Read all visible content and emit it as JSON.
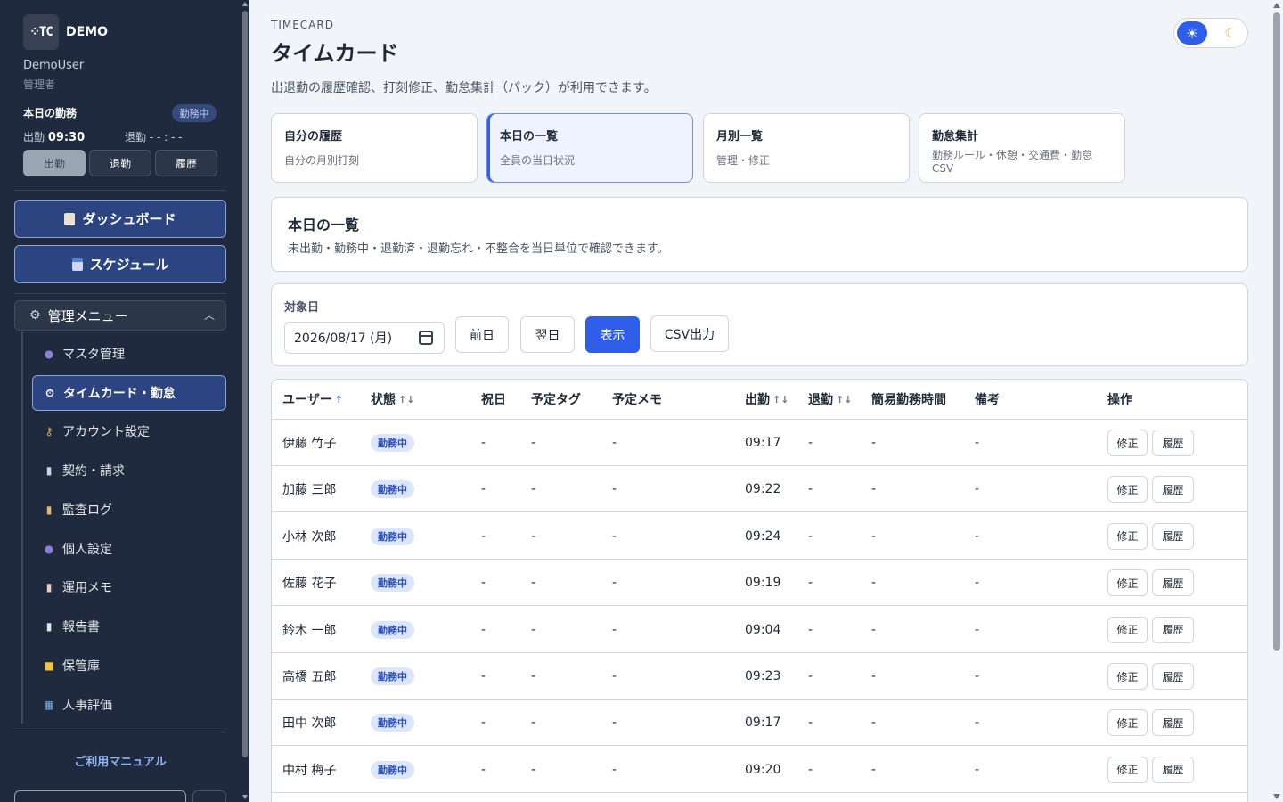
{
  "sidebar": {
    "logo_mark": "⁘TC",
    "logo_text": "DEMO",
    "user_name": "DemoUser",
    "user_role": "管理者",
    "today_label": "本日の勤務",
    "today_status": "勤務中",
    "clock_in_label": "出勤",
    "clock_in_time": "09:30",
    "clock_out_label": "退勤",
    "clock_out_time": "- - : - -",
    "punch_buttons": [
      "出勤",
      "退勤",
      "履歴"
    ],
    "dashboard_label": "ダッシュボード",
    "schedule_label": "スケジュール",
    "admin_menu_label": "管理メニュー",
    "nav_items": [
      {
        "label": "マスタ管理",
        "icon": "users-icon"
      },
      {
        "label": "タイムカード・勤怠",
        "icon": "stopwatch-icon"
      },
      {
        "label": "アカウント設定",
        "icon": "key-icon"
      },
      {
        "label": "契約・請求",
        "icon": "receipt-icon"
      },
      {
        "label": "監査ログ",
        "icon": "scroll-icon"
      },
      {
        "label": "個人設定",
        "icon": "person-icon"
      },
      {
        "label": "運用メモ",
        "icon": "memo-icon"
      },
      {
        "label": "報告書",
        "icon": "document-icon"
      },
      {
        "label": "保管庫",
        "icon": "folder-icon"
      },
      {
        "label": "人事評価",
        "icon": "bar-chart-icon"
      }
    ],
    "manual_link": "ご利用マニュアル"
  },
  "header": {
    "kicker": "TIMECARD",
    "title": "タイムカード",
    "description": "出退勤の履歴確認、打刻修正、勤怠集計（パック）が利用できます。"
  },
  "tabs": [
    {
      "title": "自分の履歴",
      "subtitle": "自分の月別打刻"
    },
    {
      "title": "本日の一覧",
      "subtitle": "全員の当日状況"
    },
    {
      "title": "月別一覧",
      "subtitle": "管理・修正"
    },
    {
      "title": "勤怠集計",
      "subtitle": "勤務ルール・休憩・交通費・勤怠CSV"
    }
  ],
  "section": {
    "title": "本日の一覧",
    "description": "未出勤・勤務中・退勤済・退勤忘れ・不整合を当日単位で確認できます。"
  },
  "filter": {
    "date_label": "対象日",
    "date_value": "2026/08/17 (月)",
    "prev_label": "前日",
    "next_label": "翌日",
    "show_label": "表示",
    "csv_label": "CSV出力"
  },
  "table": {
    "headers": {
      "user": "ユーザー",
      "status": "状態",
      "holiday": "祝日",
      "tag": "予定タグ",
      "memo": "予定メモ",
      "in": "出勤",
      "out": "退勤",
      "simple": "簡易勤務時間",
      "note": "備考",
      "ops": "操作"
    },
    "edit_label": "修正",
    "history_label": "履歴",
    "rows": [
      {
        "user": "伊藤 竹子",
        "status": "勤務中",
        "holiday": "-",
        "tag": "-",
        "memo": "-",
        "in": "09:17",
        "out": "-",
        "simple": "-",
        "note": "-"
      },
      {
        "user": "加藤 三郎",
        "status": "勤務中",
        "holiday": "-",
        "tag": "-",
        "memo": "-",
        "in": "09:22",
        "out": "-",
        "simple": "-",
        "note": "-"
      },
      {
        "user": "小林 次郎",
        "status": "勤務中",
        "holiday": "-",
        "tag": "-",
        "memo": "-",
        "in": "09:24",
        "out": "-",
        "simple": "-",
        "note": "-"
      },
      {
        "user": "佐藤 花子",
        "status": "勤務中",
        "holiday": "-",
        "tag": "-",
        "memo": "-",
        "in": "09:19",
        "out": "-",
        "simple": "-",
        "note": "-"
      },
      {
        "user": "鈴木 一郎",
        "status": "勤務中",
        "holiday": "-",
        "tag": "-",
        "memo": "-",
        "in": "09:04",
        "out": "-",
        "simple": "-",
        "note": "-"
      },
      {
        "user": "高橋 五郎",
        "status": "勤務中",
        "holiday": "-",
        "tag": "-",
        "memo": "-",
        "in": "09:23",
        "out": "-",
        "simple": "-",
        "note": "-"
      },
      {
        "user": "田中 次郎",
        "status": "勤務中",
        "holiday": "-",
        "tag": "-",
        "memo": "-",
        "in": "09:17",
        "out": "-",
        "simple": "-",
        "note": "-"
      },
      {
        "user": "中村 梅子",
        "status": "勤務中",
        "holiday": "-",
        "tag": "-",
        "memo": "-",
        "in": "09:20",
        "out": "-",
        "simple": "-",
        "note": "-"
      }
    ]
  }
}
